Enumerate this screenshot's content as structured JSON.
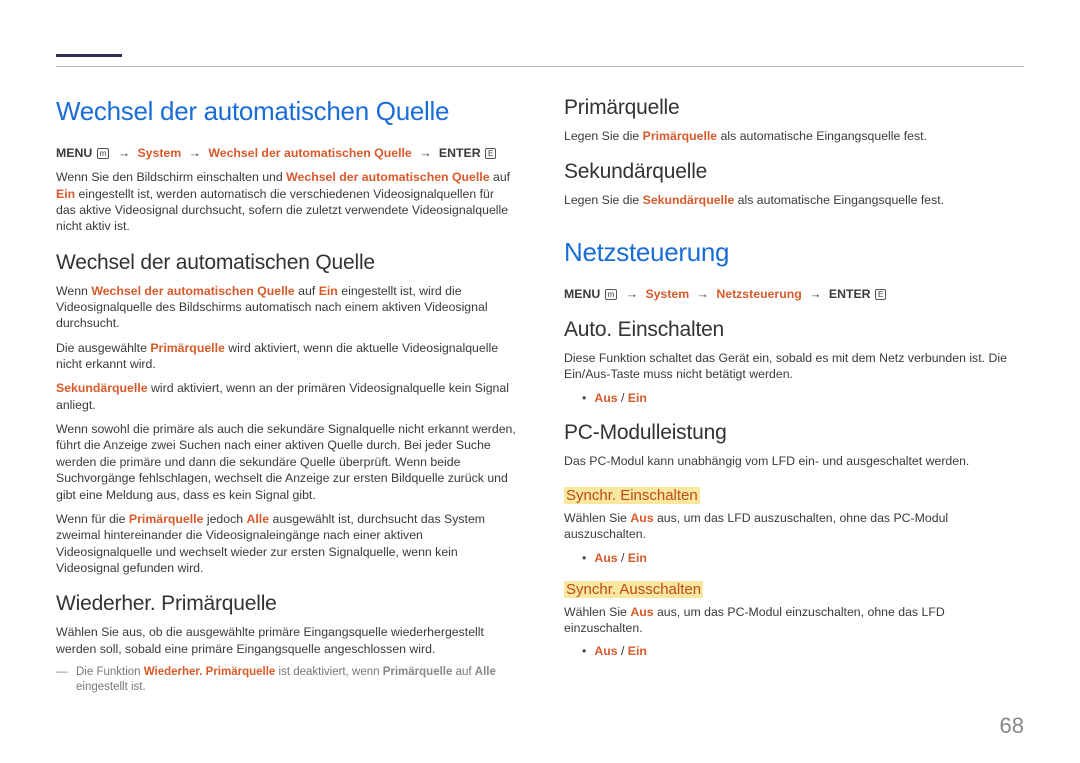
{
  "left": {
    "h1": "Wechsel der automatischen Quelle",
    "bc_menu": "MENU",
    "bc_menu_icon": "m",
    "bc_system": "System",
    "bc_item": "Wechsel der automatischen Quelle",
    "bc_enter": "ENTER",
    "bc_enter_icon": "E",
    "intro_a": "Wenn Sie den Bildschirm einschalten und ",
    "intro_em1": "Wechsel der automatischen Quelle",
    "intro_b": " auf ",
    "intro_em2": "Ein",
    "intro_c": " eingestellt ist, werden automatisch die verschiedenen Videosignalquellen für das aktive Videosignal durchsucht, sofern die zuletzt verwendete Videosignalquelle nicht aktiv ist.",
    "h2_1": "Wechsel der automatischen Quelle",
    "p1_a": "Wenn ",
    "p1_em1": "Wechsel der automatischen Quelle",
    "p1_b": " auf ",
    "p1_em2": "Ein",
    "p1_c": " eingestellt ist, wird die Videosignalquelle des Bildschirms automatisch nach einem aktiven Videosignal durchsucht.",
    "p2_a": "Die ausgewählte ",
    "p2_em1": "Primärquelle",
    "p2_b": " wird aktiviert, wenn die aktuelle Videosignalquelle nicht erkannt wird.",
    "p3_em1": "Sekundärquelle",
    "p3_a": " wird aktiviert, wenn an der primären Videosignalquelle kein Signal anliegt.",
    "p4": "Wenn sowohl die primäre als auch die sekundäre Signalquelle nicht erkannt werden, führt die Anzeige zwei Suchen nach einer aktiven Quelle durch. Bei jeder Suche werden die primäre und dann die sekundäre Quelle überprüft. Wenn beide Suchvorgänge fehlschlagen, wechselt die Anzeige zur ersten Bildquelle zurück und gibt eine Meldung aus, dass es kein Signal gibt.",
    "p5_a": "Wenn für die ",
    "p5_em1": "Primärquelle",
    "p5_b": " jedoch ",
    "p5_em2": "Alle",
    "p5_c": " ausgewählt ist, durchsucht das System zweimal hintereinander die Videosignaleingänge nach einer aktiven Videosignalquelle und wechselt wieder zur ersten Signalquelle, wenn kein Videosignal gefunden wird.",
    "h2_2": "Wiederher. Primärquelle",
    "p6": "Wählen Sie aus, ob die ausgewählte primäre Eingangsquelle wiederhergestellt werden soll, sobald eine primäre Eingangsquelle angeschlossen wird.",
    "note_a": "Die Funktion ",
    "note_em1": "Wiederher. Primärquelle",
    "note_b": " ist deaktiviert, wenn ",
    "note_em2": "Primärquelle",
    "note_c": " auf ",
    "note_em3": "Alle",
    "note_d": " eingestellt ist."
  },
  "right": {
    "h2_1": "Primärquelle",
    "p1_a": "Legen Sie die ",
    "p1_em1": "Primärquelle",
    "p1_b": " als automatische Eingangsquelle fest.",
    "h2_2": "Sekundärquelle",
    "p2_a": "Legen Sie die ",
    "p2_em1": "Sekundärquelle",
    "p2_b": " als automatische Eingangsquelle fest.",
    "h1": "Netzsteuerung",
    "bc_menu": "MENU",
    "bc_menu_icon": "m",
    "bc_system": "System",
    "bc_item": "Netzsteuerung",
    "bc_enter": "ENTER",
    "bc_enter_icon": "E",
    "h2_3": "Auto. Einschalten",
    "p3": "Diese Funktion schaltet das Gerät ein, sobald es mit dem Netz verbunden ist. Die Ein/Aus-Taste muss nicht betätigt werden.",
    "opt_aus": "Aus",
    "opt_sep": " / ",
    "opt_ein": "Ein",
    "h2_4": "PC-Modulleistung",
    "p4": "Das PC-Modul kann unabhängig vom LFD ein- und ausgeschaltet werden.",
    "h3_1": "Synchr. Einschalten",
    "p5_a": "Wählen Sie ",
    "p5_em1": "Aus",
    "p5_b": " aus, um das LFD auszuschalten, ohne das PC-Modul auszuschalten.",
    "h3_2": "Synchr. Ausschalten",
    "p6_a": "Wählen Sie ",
    "p6_em1": "Aus",
    "p6_b": " aus, um das PC-Modul einzuschalten, ohne das LFD einzuschalten."
  },
  "page": "68"
}
